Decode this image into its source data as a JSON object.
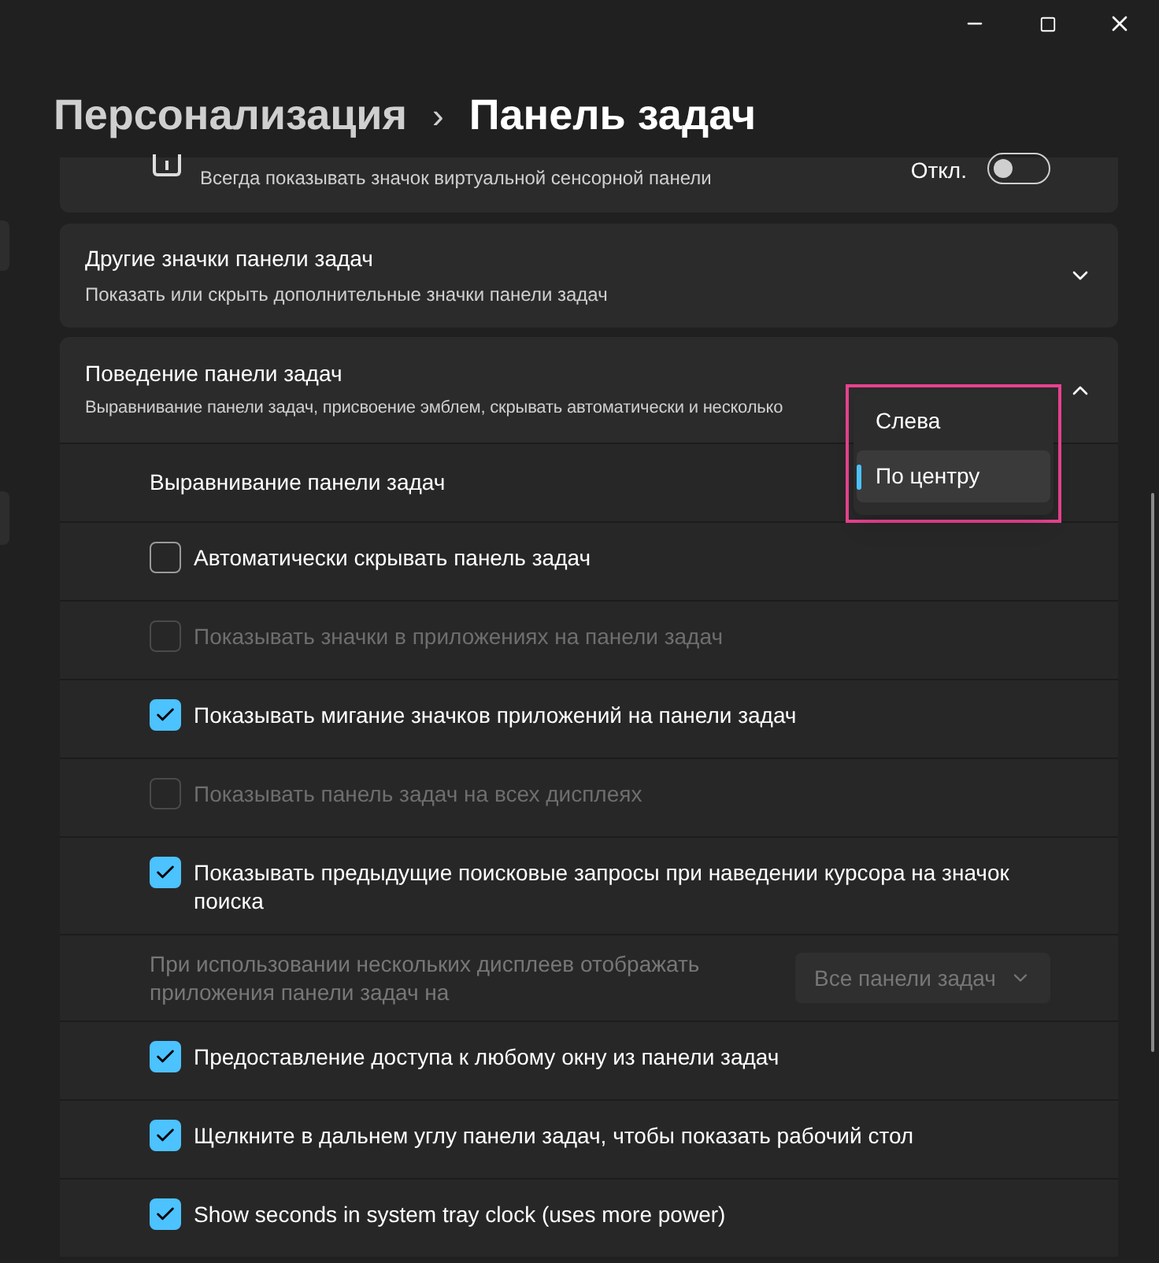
{
  "breadcrumb": {
    "parent": "Персонализация",
    "separator": "›",
    "current": "Панель задач"
  },
  "top_card": {
    "description": "Всегда показывать значок виртуальной сенсорной панели",
    "state_label": "Откл.",
    "on": false
  },
  "other_icons": {
    "title": "Другие значки панели задач",
    "description": "Показать или скрыть дополнительные значки панели задач",
    "expanded": false
  },
  "behavior": {
    "title": "Поведение панели задач",
    "description": "Выравнивание панели задач, присвоение эмблем, скрывать автоматически и несколько",
    "expanded": true,
    "rows": [
      {
        "kind": "alignment",
        "label": "Выравнивание панели задач",
        "options": [
          {
            "label": "Слева",
            "selected": false
          },
          {
            "label": "По центру",
            "selected": true
          }
        ]
      },
      {
        "kind": "checkbox",
        "label": "Автоматически скрывать панель задач",
        "checked": false,
        "disabled": false
      },
      {
        "kind": "checkbox",
        "label": "Показывать значки в приложениях на панели задач",
        "checked": false,
        "disabled": true
      },
      {
        "kind": "checkbox",
        "label": "Показывать мигание значков приложений на панели задач",
        "checked": true,
        "disabled": false
      },
      {
        "kind": "checkbox",
        "label": "Показывать панель задач на всех дисплеях",
        "checked": false,
        "disabled": true
      },
      {
        "kind": "checkbox",
        "label": "Показывать предыдущие поисковые запросы при наведении курсора на значок поиска",
        "checked": true,
        "disabled": false
      },
      {
        "kind": "dropdown",
        "label": "При использовании нескольких дисплеев отображать приложения панели задач на",
        "value": "Все панели задач",
        "disabled": true
      },
      {
        "kind": "checkbox",
        "label": "Предоставление доступа к любому окну из панели задач",
        "checked": true,
        "disabled": false
      },
      {
        "kind": "checkbox",
        "label": "Щелкните в дальнем углу панели задач, чтобы показать рабочий стол",
        "checked": true,
        "disabled": false
      },
      {
        "kind": "checkbox",
        "label": "Show seconds in system tray clock (uses more power)",
        "checked": true,
        "disabled": false
      }
    ]
  }
}
